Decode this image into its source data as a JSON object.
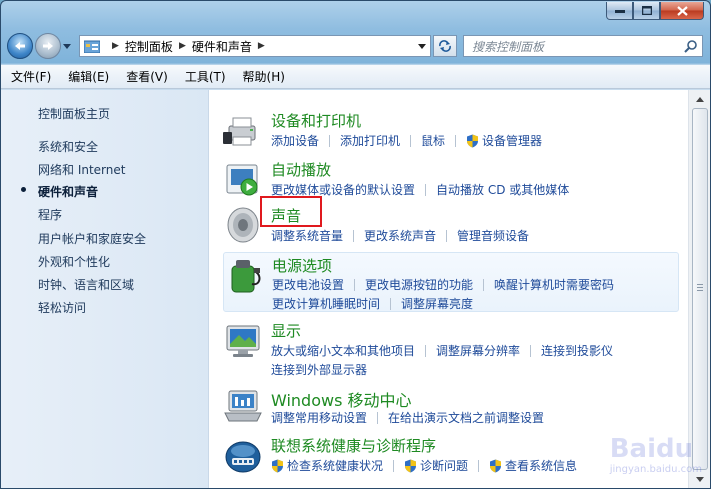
{
  "address": {
    "crumbs": [
      "控制面板",
      "硬件和声音"
    ]
  },
  "search": {
    "placeholder": "搜索控制面板"
  },
  "menu": [
    "文件(F)",
    "编辑(E)",
    "查看(V)",
    "工具(T)",
    "帮助(H)"
  ],
  "sidebar": {
    "items": [
      {
        "label": "控制面板主页"
      },
      {
        "label": "系统和安全"
      },
      {
        "label": "网络和 Internet"
      },
      {
        "label": "硬件和声音",
        "active": true
      },
      {
        "label": "程序"
      },
      {
        "label": "用户帐户和家庭安全"
      },
      {
        "label": "外观和个性化"
      },
      {
        "label": "时钟、语言和区域"
      },
      {
        "label": "轻松访问"
      }
    ]
  },
  "sections": [
    {
      "title": "设备和打印机",
      "icon": "printer-icon",
      "rows": [
        [
          {
            "label": "添加设备"
          },
          {
            "label": "添加打印机"
          },
          {
            "label": "鼠标"
          },
          {
            "label": "设备管理器",
            "shield": true
          }
        ]
      ]
    },
    {
      "title": "自动播放",
      "icon": "autoplay-icon",
      "rows": [
        [
          {
            "label": "更改媒体或设备的默认设置"
          },
          {
            "label": "自动播放 CD 或其他媒体"
          }
        ]
      ]
    },
    {
      "title": "声音",
      "icon": "speaker-icon",
      "rows": [
        [
          {
            "label": "调整系统音量"
          },
          {
            "label": "更改系统声音"
          },
          {
            "label": "管理音频设备"
          }
        ]
      ]
    },
    {
      "title": "电源选项",
      "icon": "power-icon",
      "rows": [
        [
          {
            "label": "更改电池设置"
          },
          {
            "label": "更改电源按钮的功能"
          },
          {
            "label": "唤醒计算机时需要密码"
          }
        ],
        [
          {
            "label": "更改计算机睡眠时间"
          },
          {
            "label": "调整屏幕亮度"
          }
        ]
      ]
    },
    {
      "title": "显示",
      "icon": "display-icon",
      "rows": [
        [
          {
            "label": "放大或缩小文本和其他项目"
          },
          {
            "label": "调整屏幕分辨率"
          },
          {
            "label": "连接到投影仪"
          }
        ],
        [
          {
            "label": "连接到外部显示器"
          }
        ]
      ]
    },
    {
      "title": "Windows 移动中心",
      "icon": "mobility-center-icon",
      "rows": [
        [
          {
            "label": "调整常用移动设置"
          },
          {
            "label": "在给出演示文档之前调整设置"
          }
        ]
      ]
    },
    {
      "title": "联想系统健康与诊断程序",
      "icon": "health-diagnostics-icon",
      "rows": [
        [
          {
            "label": "检查系统健康状况",
            "shield": true
          },
          {
            "label": "诊断问题",
            "shield": true
          },
          {
            "label": "查看系统信息",
            "shield": true
          }
        ]
      ]
    }
  ],
  "watermark": {
    "brand": "Baidu",
    "sub": "jingyan.baidu.com"
  }
}
